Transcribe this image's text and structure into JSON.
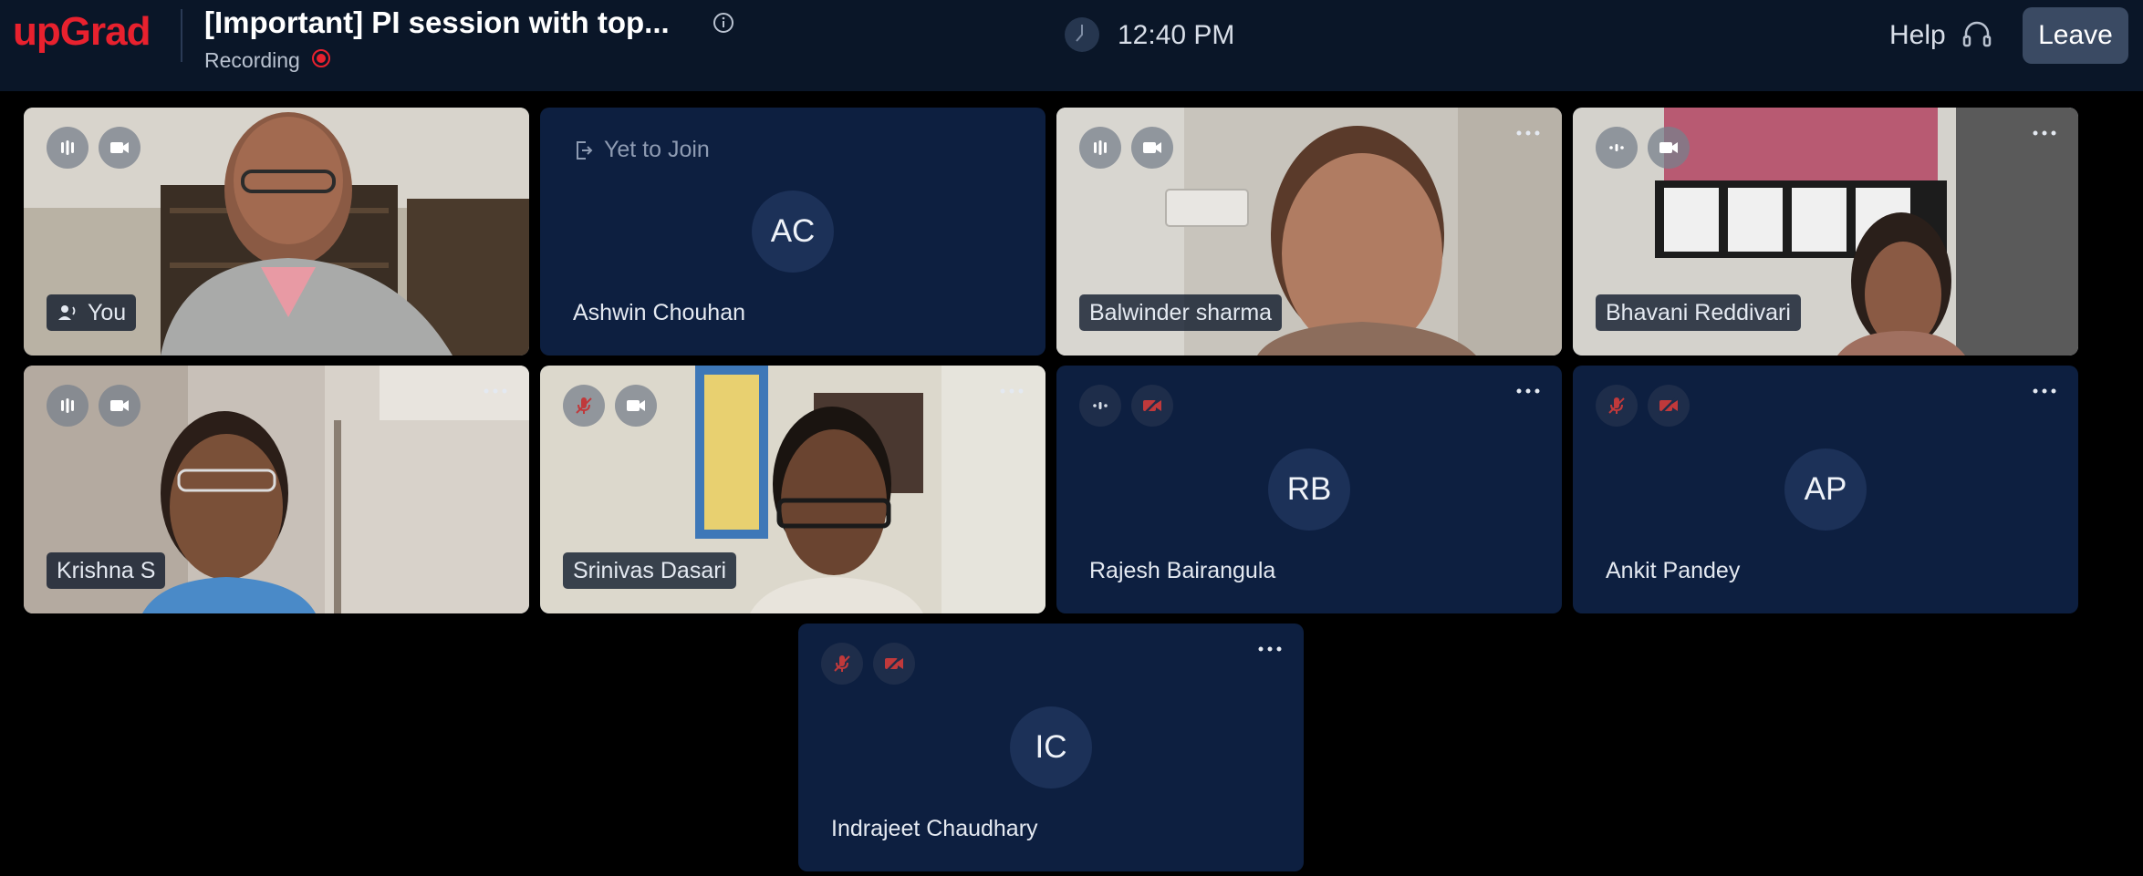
{
  "header": {
    "logo": "upGrad",
    "title": "[Important] PI session with top...",
    "recording_label": "Recording",
    "time": "12:40 PM",
    "help_label": "Help",
    "leave_label": "Leave"
  },
  "colors": {
    "brand": "#e8212e",
    "header_bg": "#0a1628",
    "tile_bg": "#0d1f40",
    "muted_red": "#c0393b"
  },
  "tiles": [
    {
      "name": "You",
      "type": "video",
      "mic": "active",
      "camera": "on"
    },
    {
      "name": "Ashwin Chouhan",
      "type": "avatar",
      "initials": "AC",
      "status": "Yet to Join"
    },
    {
      "name": "Balwinder sharma",
      "type": "video",
      "mic": "active",
      "camera": "on"
    },
    {
      "name": "Bhavani Reddivari",
      "type": "video",
      "mic": "idle",
      "camera": "on"
    },
    {
      "name": "Krishna S",
      "type": "video",
      "mic": "active",
      "camera": "on"
    },
    {
      "name": "Srinivas Dasari",
      "type": "video",
      "mic": "muted",
      "camera": "on"
    },
    {
      "name": "Rajesh Bairangula",
      "type": "avatar",
      "initials": "RB",
      "mic": "idle",
      "camera": "off"
    },
    {
      "name": "Ankit Pandey",
      "type": "avatar",
      "initials": "AP",
      "mic": "muted",
      "camera": "off"
    },
    {
      "name": "Indrajeet Chaudhary",
      "type": "avatar",
      "initials": "IC",
      "mic": "muted",
      "camera": "off"
    }
  ]
}
